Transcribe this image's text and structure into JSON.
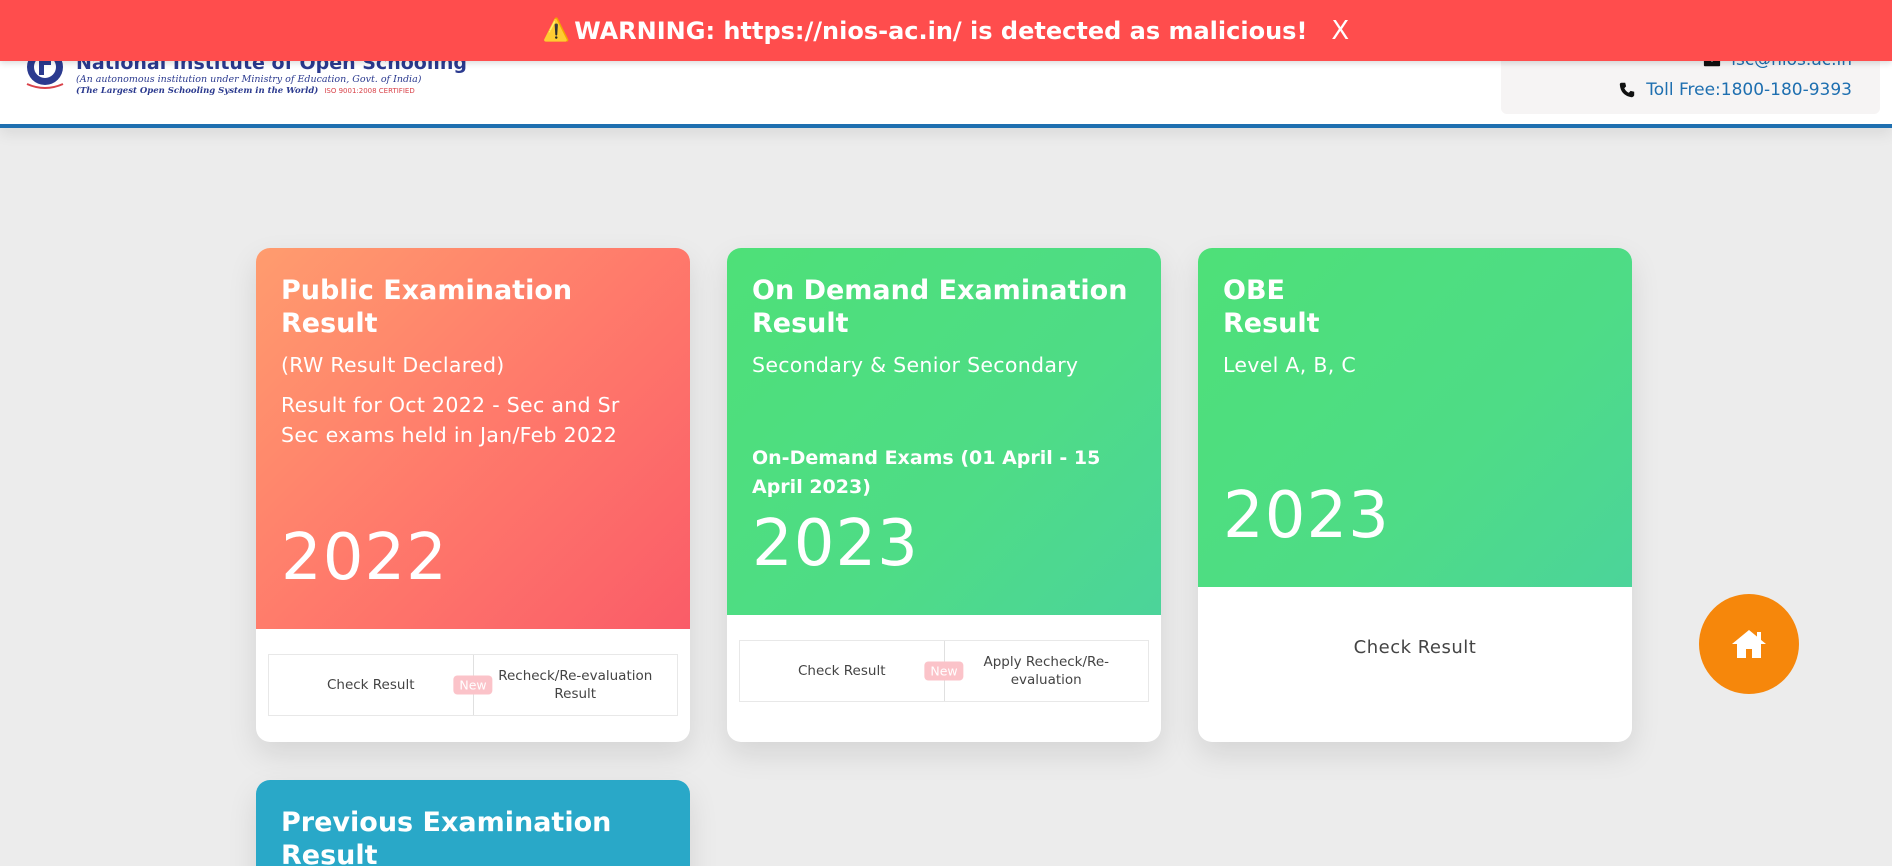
{
  "warning": {
    "icon": "warning-icon",
    "text": "WARNING: https://nios-ac.in/ is detected as malicious!",
    "close_label": "X"
  },
  "header": {
    "logo": {
      "name": "National Institute of Open Schooling",
      "sub1": "(An autonomous institution under Ministry of Education, Govt. of India)",
      "sub2": "(The Largest Open Schooling System in the World)",
      "iso": "ISO 9001:2008 CERTIFIED"
    },
    "contact": {
      "email": "lsc@nios.ac.in",
      "phone": "Toll Free:1800-180-9393"
    }
  },
  "cards": {
    "public": {
      "title": "Public Examination Result",
      "sub": "(RW Result Declared)",
      "sub2": "Result for Oct 2022 - Sec and Sr Sec exams held in Jan/Feb 2022",
      "year": "2022",
      "btn1": "Check Result",
      "badge": "New",
      "btn2": "Recheck/Re-evaluation Result"
    },
    "ondemand": {
      "title": "On Demand Examination Result",
      "sub": "Secondary & Senior Secondary",
      "bold": "On-Demand Exams (01 April - 15 April 2023)",
      "year": "2023",
      "btn1": "Check Result",
      "badge": "New",
      "btn2": "Apply Recheck/Re-evaluation"
    },
    "obe": {
      "title_line1": "OBE",
      "title_line2": "Result",
      "sub": "Level A, B, C",
      "year": "2023",
      "btn": "Check Result"
    },
    "previous": {
      "title": "Previous Examination Result"
    }
  },
  "colors": {
    "warning_bg": "#ff4d4d",
    "header_border": "#1e6fb0",
    "orange_card": "#fa6f69",
    "green_card": "#4edc86",
    "blue_card": "#29a8c8",
    "home_button": "#f6870b"
  },
  "home_button": {
    "icon": "home-icon"
  }
}
